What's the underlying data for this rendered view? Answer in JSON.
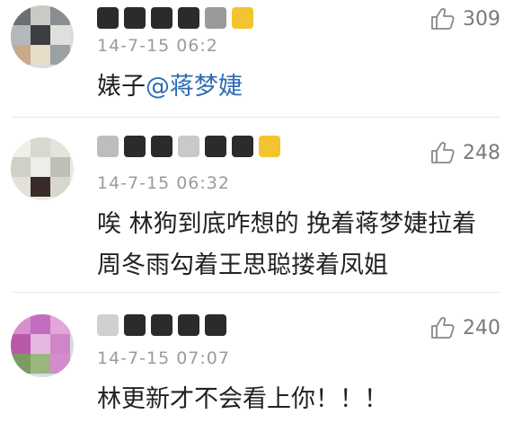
{
  "comments": [
    {
      "author": "",
      "time": "14-7-15 06:2",
      "text_prefix": "婊子",
      "mention": "@蒋梦婕",
      "likes": "309"
    },
    {
      "author": "",
      "time": "14-7-15 06:32",
      "text_lines": [
        "唉 林狗到底咋想的 挽着蒋梦婕拉着",
        "周冬雨勾着王思聪搂着凤姐"
      ],
      "likes": "248"
    },
    {
      "author": "",
      "time": "14-7-15 07:07",
      "text": "林更新才不会看上你！！！",
      "likes": "240"
    }
  ],
  "icons": {
    "like": "thumbs-up-icon"
  },
  "colors": {
    "mention": "#2f6db5",
    "meta": "#9b9b9b",
    "divider": "#e6e6e6"
  }
}
